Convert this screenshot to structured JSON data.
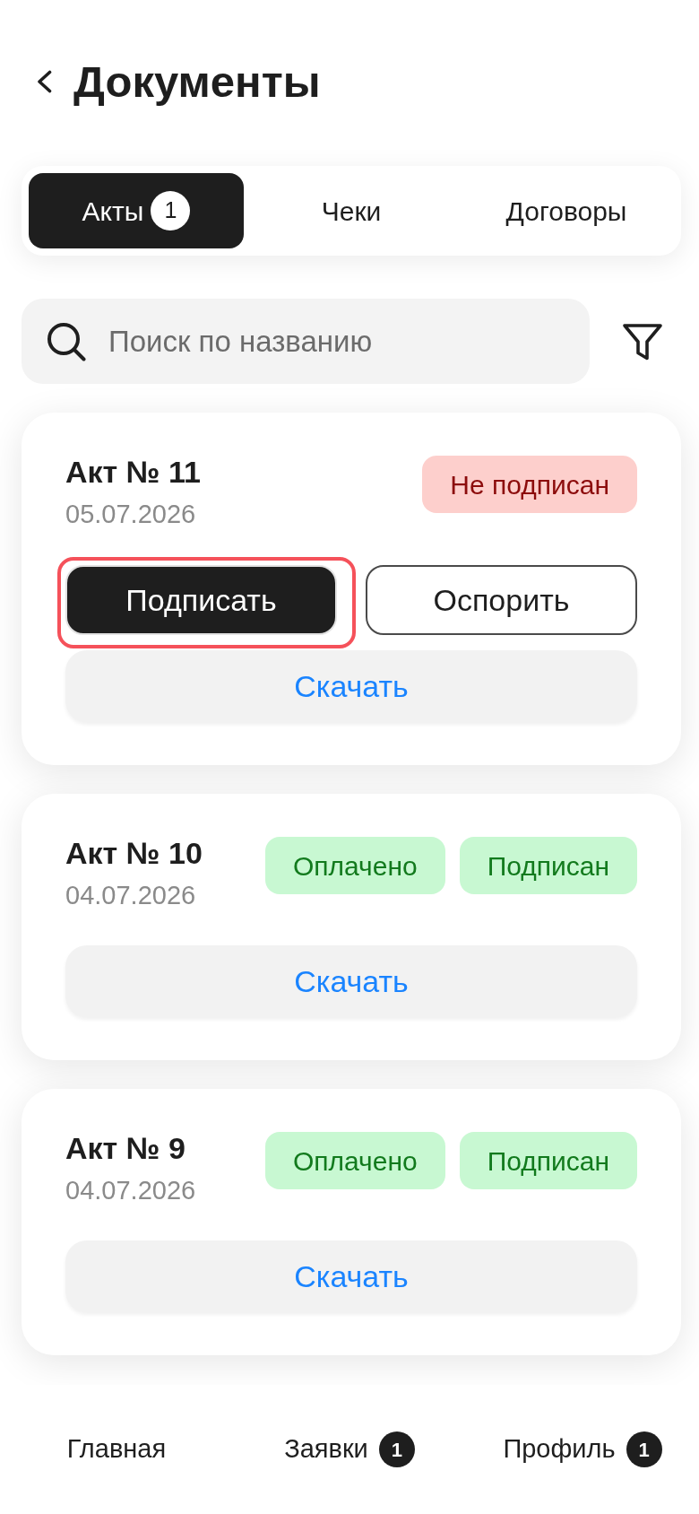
{
  "header": {
    "title": "Документы"
  },
  "tabs": [
    {
      "label": "Акты",
      "badge": "1",
      "selected": true
    },
    {
      "label": "Чеки",
      "selected": false
    },
    {
      "label": "Договоры",
      "selected": false
    }
  ],
  "search": {
    "placeholder": "Поиск по названию"
  },
  "documents": [
    {
      "title": "Акт № 11",
      "date": "05.07.2026",
      "statuses": [
        {
          "label": "Не подписан",
          "kind": "negative"
        }
      ],
      "actions": [
        {
          "label": "Подписать",
          "kind": "primary",
          "highlighted": true
        },
        {
          "label": "Оспорить",
          "kind": "outline",
          "highlighted": false
        }
      ],
      "download": "Скачать"
    },
    {
      "title": "Акт № 10",
      "date": "04.07.2026",
      "statuses": [
        {
          "label": "Оплачено",
          "kind": "positive"
        },
        {
          "label": "Подписан",
          "kind": "positive"
        }
      ],
      "download": "Скачать"
    },
    {
      "title": "Акт № 9",
      "date": "04.07.2026",
      "statuses": [
        {
          "label": "Оплачено",
          "kind": "positive"
        },
        {
          "label": "Подписан",
          "kind": "positive"
        }
      ],
      "download": "Скачать"
    }
  ],
  "bottom_nav": [
    {
      "label": "Главная"
    },
    {
      "label": "Заявки",
      "badge": "1"
    },
    {
      "label": "Профиль",
      "badge": "1"
    }
  ]
}
